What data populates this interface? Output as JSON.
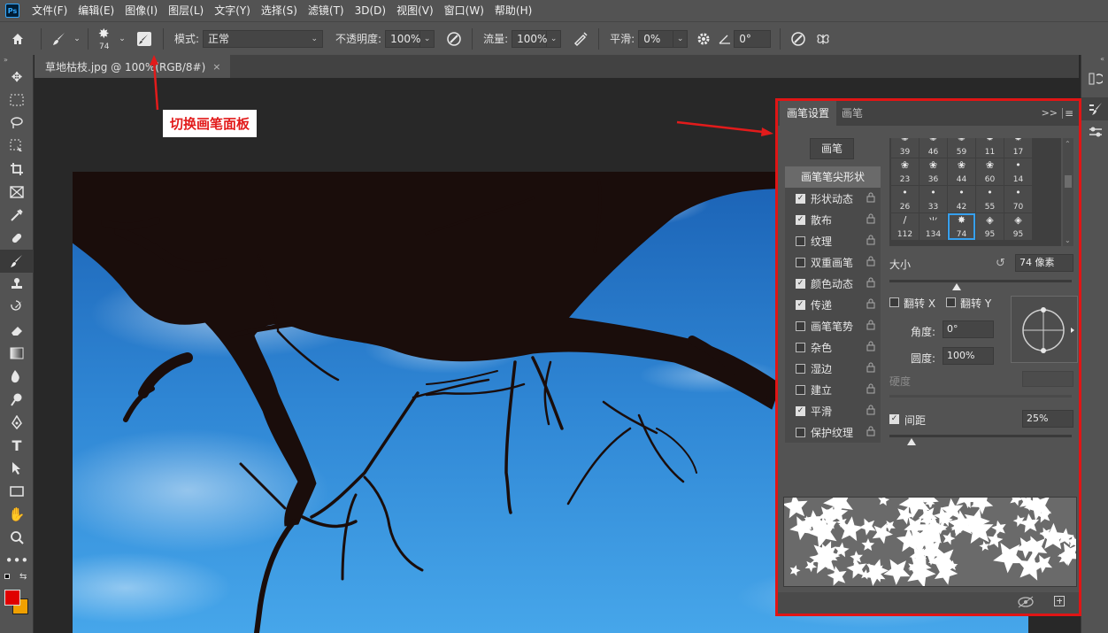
{
  "app": {
    "logo_text": "Ps"
  },
  "menu": [
    "文件(F)",
    "编辑(E)",
    "图像(I)",
    "图层(L)",
    "文字(Y)",
    "选择(S)",
    "滤镜(T)",
    "3D(D)",
    "视图(V)",
    "窗口(W)",
    "帮助(H)"
  ],
  "options_bar": {
    "brush_size": "74",
    "mode_label": "模式:",
    "mode_value": "正常",
    "opacity_label": "不透明度:",
    "opacity_value": "100%",
    "flow_label": "流量:",
    "flow_value": "100%",
    "smoothing_label": "平滑:",
    "smoothing_value": "0%",
    "angle_value": "0°"
  },
  "document_tab": {
    "title": "草地枯枝.jpg @ 100%(RGB/8#)",
    "close_glyph": "×"
  },
  "annotation": {
    "text": "切换画笔面板",
    "color": "#e21b1b"
  },
  "brush_panel": {
    "tabs": [
      "画笔设置",
      "画笔"
    ],
    "collapse_glyph": ">>",
    "brushes_button": "画笔",
    "tip_shape_label": "画笔笔尖形状",
    "options": [
      {
        "label": "形状动态",
        "checked": true
      },
      {
        "label": "散布",
        "checked": true
      },
      {
        "label": "纹理",
        "checked": false
      },
      {
        "label": "双重画笔",
        "checked": false
      },
      {
        "label": "颜色动态",
        "checked": true
      },
      {
        "label": "传递",
        "checked": true
      },
      {
        "label": "画笔笔势",
        "checked": false
      },
      {
        "label": "杂色",
        "checked": false
      },
      {
        "label": "湿边",
        "checked": false
      },
      {
        "label": "建立",
        "checked": false
      },
      {
        "label": "平滑",
        "checked": true
      },
      {
        "label": "保护纹理",
        "checked": false
      }
    ],
    "tips": [
      "39",
      "46",
      "59",
      "11",
      "17",
      "23",
      "36",
      "44",
      "60",
      "14",
      "26",
      "33",
      "42",
      "55",
      "70",
      "112",
      "134",
      "74",
      "95",
      "95"
    ],
    "selected_tip_index": 17,
    "size_label": "大小",
    "size_value": "74 像素",
    "size_fraction": 0.37,
    "flip_x_label": "翻转 X",
    "flip_y_label": "翻转 Y",
    "angle_label": "角度:",
    "angle_value": "0°",
    "roundness_label": "圆度:",
    "roundness_value": "100%",
    "hardness_label": "硬度",
    "spacing_label": "间距",
    "spacing_checked": true,
    "spacing_value": "25%",
    "spacing_fraction": 0.12
  },
  "colors": {
    "foreground": "#e00000",
    "background": "#f0a000",
    "panel_border": "#e01515"
  }
}
